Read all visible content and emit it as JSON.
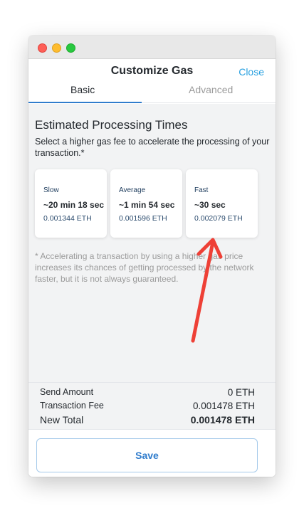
{
  "window": {
    "controls": [
      "close",
      "minimize",
      "zoom"
    ]
  },
  "header": {
    "title": "Customize Gas",
    "close_label": "Close"
  },
  "tabs": [
    {
      "label": "Basic",
      "active": true
    },
    {
      "label": "Advanced",
      "active": false
    }
  ],
  "estimates": {
    "title": "Estimated Processing Times",
    "description": "Select a higher gas fee to accelerate the processing of your transaction.*",
    "options": [
      {
        "label": "Slow",
        "time": "~20 min 18 sec",
        "fee": "0.001344 ETH"
      },
      {
        "label": "Average",
        "time": "~1 min 54 sec",
        "fee": "0.001596 ETH"
      },
      {
        "label": "Fast",
        "time": "~30 sec",
        "fee": "0.002079 ETH"
      }
    ],
    "footnote": "* Accelerating a transaction by using a higher gas price increases its chances of getting processed by the network faster, but it is not always guaranteed."
  },
  "totals": {
    "send_amount_label": "Send Amount",
    "send_amount_value": "0 ETH",
    "transaction_fee_label": "Transaction Fee",
    "transaction_fee_value": "0.001478 ETH",
    "new_total_label": "New Total",
    "new_total_value": "0.001478 ETH"
  },
  "footer": {
    "save_label": "Save"
  },
  "colors": {
    "accent_blue": "#2f7ccc",
    "link_blue": "#2aa1e0",
    "annotation_red": "#ee4036"
  }
}
